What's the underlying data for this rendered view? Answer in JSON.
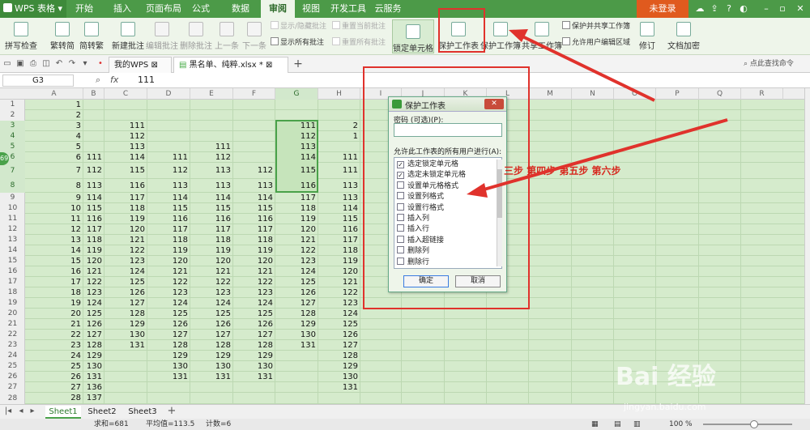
{
  "title_bar": {
    "app_name": "WPS 表格",
    "menu_tabs": [
      "开始",
      "插入",
      "页面布局",
      "公式",
      "数据",
      "审阅",
      "视图",
      "开发工具",
      "云服务"
    ],
    "active_tab": "审阅",
    "login": "未登录"
  },
  "ribbon": {
    "spellcheck": "拼写检查",
    "trad_to_simp": "繁转简",
    "simp_to_trad": "简转繁",
    "new_comment": "新建批注",
    "edit_comment": "编辑批注",
    "delete_comment": "删除批注",
    "prev": "上一条",
    "next": "下一条",
    "show_hide_comment": "显示/隐藏批注",
    "show_all_comments": "显示所有批注",
    "reset_current_comment": "重置当前批注",
    "reset_all_comments": "重置所有批注",
    "lock_cell": "锁定单元格",
    "protect_sheet": "保护工作表",
    "protect_workbook": "保护工作簿",
    "share_workbook": "共享工作簿",
    "protect_share_workbook": "保护并共享工作簿",
    "allow_edit_ranges": "允许用户编辑区域",
    "track_changes": "修订",
    "doc_encrypt": "文档加密"
  },
  "tabs_bar": {
    "tabs": [
      "我的WPS",
      "黑名单、纯粹.xlsx *"
    ],
    "command_search": "点此查找命令"
  },
  "formula_bar": {
    "cell_ref": "G3",
    "fx": "fx",
    "value": "111"
  },
  "grid": {
    "columns": [
      "A",
      "B",
      "C",
      "D",
      "E",
      "F",
      "G",
      "H",
      "I",
      "J",
      "K",
      "L",
      "M",
      "N",
      "O",
      "P",
      "Q",
      "R"
    ],
    "rows": [
      "1",
      "2",
      "3",
      "4",
      "5",
      "6",
      "7",
      "8",
      "9",
      "10",
      "11",
      "12",
      "13",
      "14",
      "15",
      "16",
      "17",
      "18",
      "19",
      "20",
      "21",
      "22",
      "23",
      "24",
      "25",
      "26",
      "27",
      "28"
    ],
    "colA": [
      "1",
      "2",
      "3",
      "4",
      "5",
      "6",
      "7",
      "8",
      "9",
      "10",
      "11",
      "12",
      "13",
      "14",
      "15",
      "16",
      "17",
      "18",
      "19",
      "20",
      "21",
      "22",
      "23",
      "24",
      "25",
      "26",
      "27",
      "28"
    ],
    "colB": [
      "",
      "",
      "",
      "",
      "",
      "111",
      "112",
      "113",
      "114",
      "115",
      "116",
      "117",
      "118",
      "119",
      "120",
      "121",
      "122",
      "123",
      "124",
      "125",
      "126",
      "127",
      "128",
      "129",
      "130",
      "131",
      "136",
      "137"
    ],
    "colC": [
      "",
      "",
      "111",
      "112",
      "113",
      "114",
      "115",
      "116",
      "117",
      "118",
      "119",
      "120",
      "121",
      "122",
      "123",
      "124",
      "125",
      "126",
      "127",
      "128",
      "129",
      "130",
      "131",
      "",
      "",
      "",
      "",
      ""
    ],
    "colD": [
      "",
      "",
      "",
      "",
      "",
      "111",
      "112",
      "113",
      "114",
      "115",
      "116",
      "117",
      "118",
      "119",
      "120",
      "121",
      "122",
      "123",
      "124",
      "125",
      "126",
      "127",
      "128",
      "129",
      "130",
      "131",
      "",
      ""
    ],
    "colE": [
      "",
      "",
      "",
      "",
      "111",
      "112",
      "113",
      "113",
      "114",
      "115",
      "116",
      "117",
      "118",
      "119",
      "120",
      "121",
      "122",
      "123",
      "124",
      "125",
      "126",
      "127",
      "128",
      "129",
      "130",
      "131",
      "",
      ""
    ],
    "colF": [
      "",
      "",
      "",
      "",
      "",
      "",
      "112",
      "113",
      "114",
      "115",
      "116",
      "117",
      "118",
      "119",
      "120",
      "121",
      "122",
      "123",
      "124",
      "125",
      "126",
      "127",
      "128",
      "129",
      "130",
      "131",
      "",
      ""
    ],
    "colG": [
      "",
      "",
      "111",
      "112",
      "113",
      "114",
      "115",
      "116",
      "117",
      "118",
      "119",
      "120",
      "121",
      "122",
      "123",
      "124",
      "125",
      "126",
      "127",
      "128",
      "129",
      "130",
      "131",
      "",
      "",
      "",
      "",
      ""
    ],
    "colH": [
      "",
      "",
      "2",
      "1",
      "",
      "111",
      "111",
      "113",
      "113",
      "114",
      "115",
      "116",
      "117",
      "118",
      "119",
      "120",
      "121",
      "122",
      "123",
      "124",
      "125",
      "126",
      "127",
      "128",
      "129",
      "130",
      "131",
      ""
    ]
  },
  "sheets": [
    "Sheet1",
    "Sheet2",
    "Sheet3"
  ],
  "status": {
    "sum": "求和=681",
    "avg": "平均值=113.5",
    "count": "计数=6",
    "zoom": "100 %"
  },
  "dialog": {
    "title": "保护工作表",
    "password_label": "密码 (可选)(P):",
    "allow_label": "允许此工作表的所有用户进行(A):",
    "options": [
      "选定锁定单元格",
      "选定未锁定单元格",
      "设置单元格格式",
      "设置列格式",
      "设置行格式",
      "插入列",
      "插入行",
      "插入超链接",
      "删除列",
      "删除行"
    ],
    "checked": [
      true,
      true,
      false,
      false,
      false,
      false,
      false,
      false,
      false,
      false
    ],
    "ok": "确定",
    "cancel": "取消"
  },
  "annotation": {
    "steps": "三步  第四步  第五步  第六步",
    "color": "#e0322c"
  },
  "watermark": {
    "text": "Bai 经验",
    "url": "jingyan.baidu.com"
  },
  "side_badge": "69"
}
